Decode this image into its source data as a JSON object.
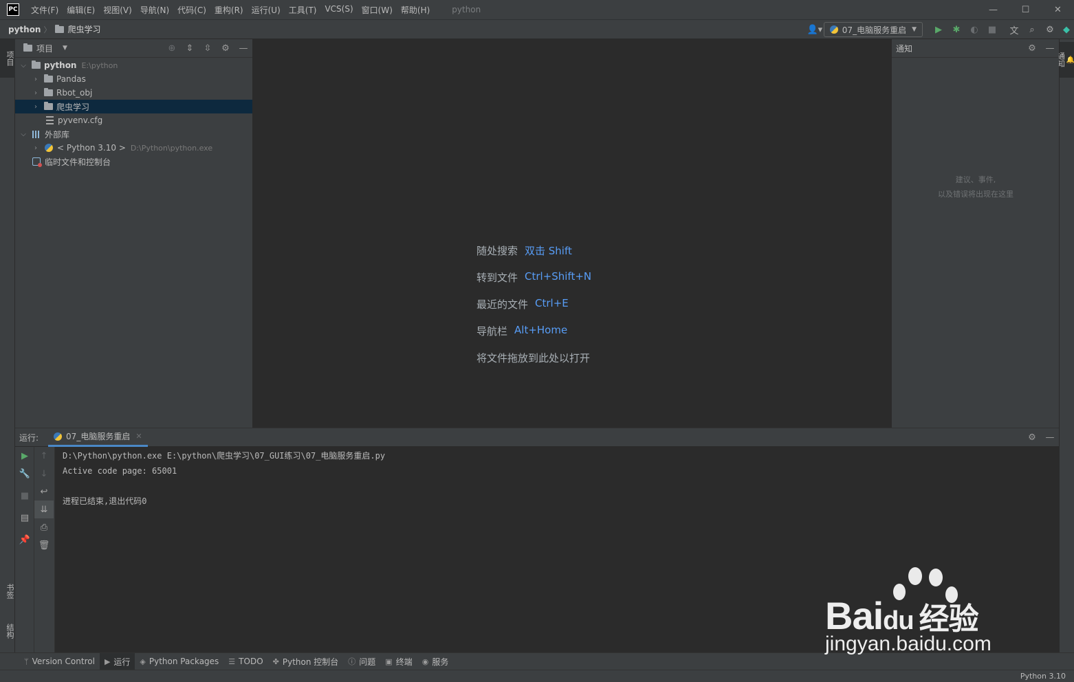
{
  "titlebar": {
    "logo": "PC",
    "menu": [
      "文件(F)",
      "编辑(E)",
      "视图(V)",
      "导航(N)",
      "代码(C)",
      "重构(R)",
      "运行(U)",
      "工具(T)",
      "VCS(S)",
      "窗口(W)",
      "帮助(H)"
    ],
    "window_title": "python",
    "controls": [
      "—",
      "☐",
      "✕"
    ]
  },
  "navbar": {
    "root": "python",
    "child": "爬虫学习",
    "run_config": "07_电脑服务重启"
  },
  "left_stripe": {
    "project_tab": "项目",
    "bookmarks_tab": "书签",
    "structure_tab": "结构"
  },
  "right_stripe": {
    "notifications_tab": "通知"
  },
  "project_panel": {
    "title": "项目",
    "tree": [
      {
        "label": "python",
        "extra": "E:\\python"
      },
      {
        "label": "Pandas"
      },
      {
        "label": "Rbot_obj"
      },
      {
        "label": "爬虫学习"
      },
      {
        "label": "pyvenv.cfg"
      },
      {
        "label": "外部库"
      },
      {
        "label": "< Python 3.10 >",
        "extra": "D:\\Python\\python.exe"
      },
      {
        "label": "临时文件和控制台"
      }
    ]
  },
  "editor": {
    "hints": [
      {
        "text": "随处搜索",
        "key": "双击 Shift"
      },
      {
        "text": "转到文件",
        "key": "Ctrl+Shift+N"
      },
      {
        "text": "最近的文件",
        "key": "Ctrl+E"
      },
      {
        "text": "导航栏",
        "key": "Alt+Home"
      },
      {
        "text": "将文件拖放到此处以打开",
        "key": ""
      }
    ]
  },
  "notifications": {
    "title": "通知",
    "empty_line1": "建议、事件,",
    "empty_line2": "以及错误将出现在这里"
  },
  "run_panel": {
    "label": "运行:",
    "tab": "07_电脑服务重启",
    "console": [
      "D:\\Python\\python.exe E:\\python\\爬虫学习\\07_GUI练习\\07_电脑服务重启.py",
      "Active code page: 65001",
      "",
      "进程已结束,退出代码0"
    ]
  },
  "bottom_bar": {
    "items": [
      "Version Control",
      "运行",
      "Python Packages",
      "TODO",
      "Python 控制台",
      "问题",
      "终端",
      "服务"
    ]
  },
  "status_bar": {
    "interpreter": "Python 3.10"
  },
  "watermark": {
    "brand": "Bai",
    "brand_du": "du",
    "brand_cn": "经验",
    "url": "jingyan.baidu.com"
  },
  "colors": {
    "accent": "#589df6",
    "selection": "#0d293e",
    "run_green": "#59a869"
  }
}
